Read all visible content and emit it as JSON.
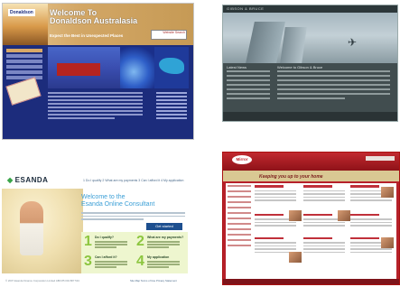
{
  "thumbnails": {
    "donaldson": {
      "logo": "Donaldson",
      "title_line1": "Welcome To",
      "title_line2": "Donaldson Australasia",
      "tagline": "Expect the Best in Unexpected Places",
      "search_text": "Website Search",
      "colors": {
        "background": "#1c2c7c",
        "header": "#d3a766"
      }
    },
    "gibson": {
      "brand": "GIBSON & BRUCE",
      "left_heading": "Latest News",
      "right_heading": "Welcome to Gibson & Bruce",
      "plane_icon": "airplane-icon",
      "colors": {
        "background": "#3e4a4c"
      }
    },
    "esanda": {
      "logo": "ESANDA",
      "logo_mark": "◆",
      "top_nav": "1 Do I qualify   2 What are my payments   3 Can I afford it   4 My application",
      "title_line1": "Welcome to the",
      "title_line2": "Esanda Online Consultant",
      "get_started": "Get started",
      "steps": [
        {
          "num": "1",
          "title": "Do I qualify?"
        },
        {
          "num": "2",
          "title": "What are my payments?"
        },
        {
          "num": "3",
          "title": "Can I afford it?"
        },
        {
          "num": "4",
          "title": "My application"
        }
      ],
      "footer": "© 2007 Esanda Finance Corporation Limited  ABN 85 004 887 534",
      "footer_links": "Site Map   Terms of Use   Privacy Statement",
      "colors": {
        "accent": "#8cc63f",
        "title": "#3b9fd6"
      }
    },
    "redsite": {
      "logo": "Mirror",
      "tagline": "Keeping you up to your home",
      "colors": {
        "background": "#b6212a",
        "banner": "#d9c893"
      }
    }
  }
}
